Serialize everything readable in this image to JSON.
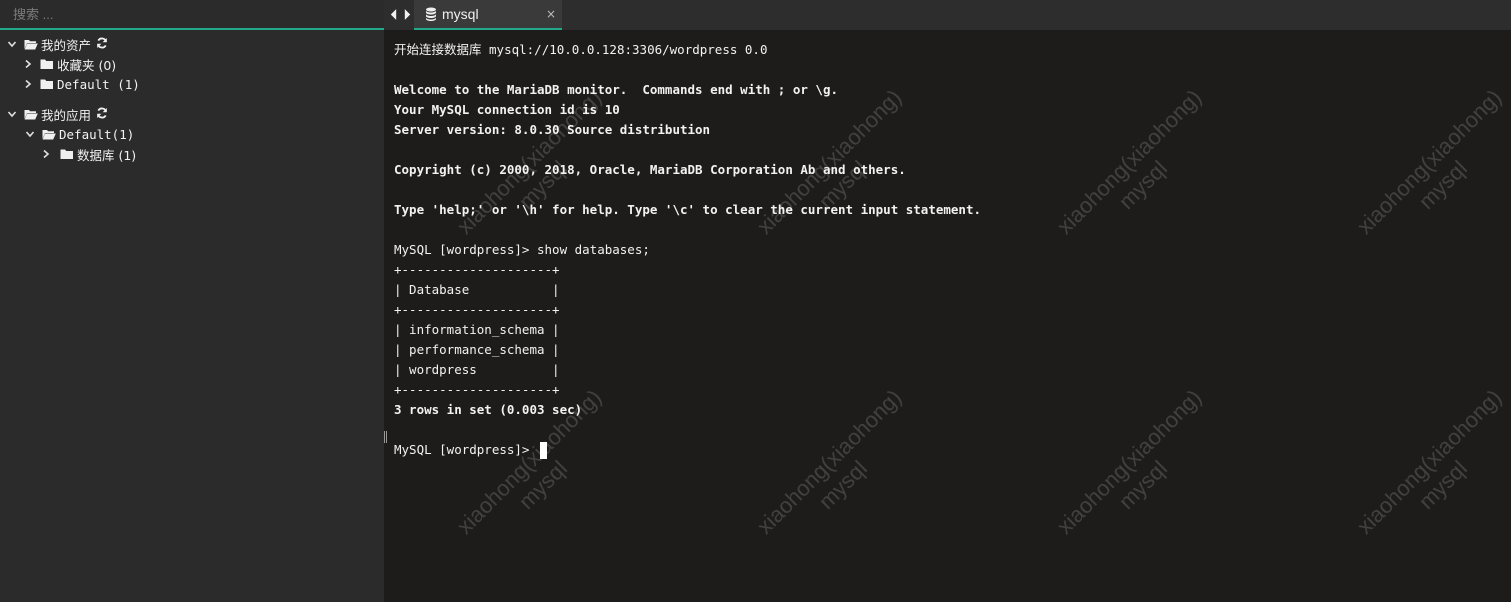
{
  "sidebar": {
    "search_placeholder": "搜索 ...",
    "tree": {
      "assets": {
        "label": "我的资产"
      },
      "favorites": {
        "label": "收藏夹 (0)"
      },
      "default_assets": {
        "label": "Default (1)"
      },
      "apps": {
        "label": "我的应用"
      },
      "default_apps": {
        "label": "Default(1)"
      },
      "database": {
        "label": "数据库 (1)"
      }
    }
  },
  "tab": {
    "label": "mysql",
    "close": "×"
  },
  "terminal": {
    "lines": [
      "开始连接数据库 mysql://10.0.0.128:3306/wordpress 0.0",
      "",
      "Welcome to the MariaDB monitor.  Commands end with ; or \\g.",
      "Your MySQL connection id is 10",
      "Server version: 8.0.30 Source distribution",
      "",
      "Copyright (c) 2000, 2018, Oracle, MariaDB Corporation Ab and others.",
      "",
      "Type 'help;' or '\\h' for help. Type '\\c' to clear the current input statement.",
      "",
      "MySQL [wordpress]> show databases;",
      "+--------------------+",
      "| Database           |",
      "+--------------------+",
      "| information_schema |",
      "| performance_schema |",
      "| wordpress          |",
      "+--------------------+",
      "3 rows in set (0.003 sec)",
      "",
      "MySQL [wordpress]> "
    ]
  },
  "watermark": {
    "line1": "xiaohong(xiaohong)",
    "line2": "mysql"
  },
  "colors": {
    "accent": "#22a88a",
    "sidebar_bg": "#2b2b2b",
    "terminal_bg": "#1e1c1b"
  }
}
